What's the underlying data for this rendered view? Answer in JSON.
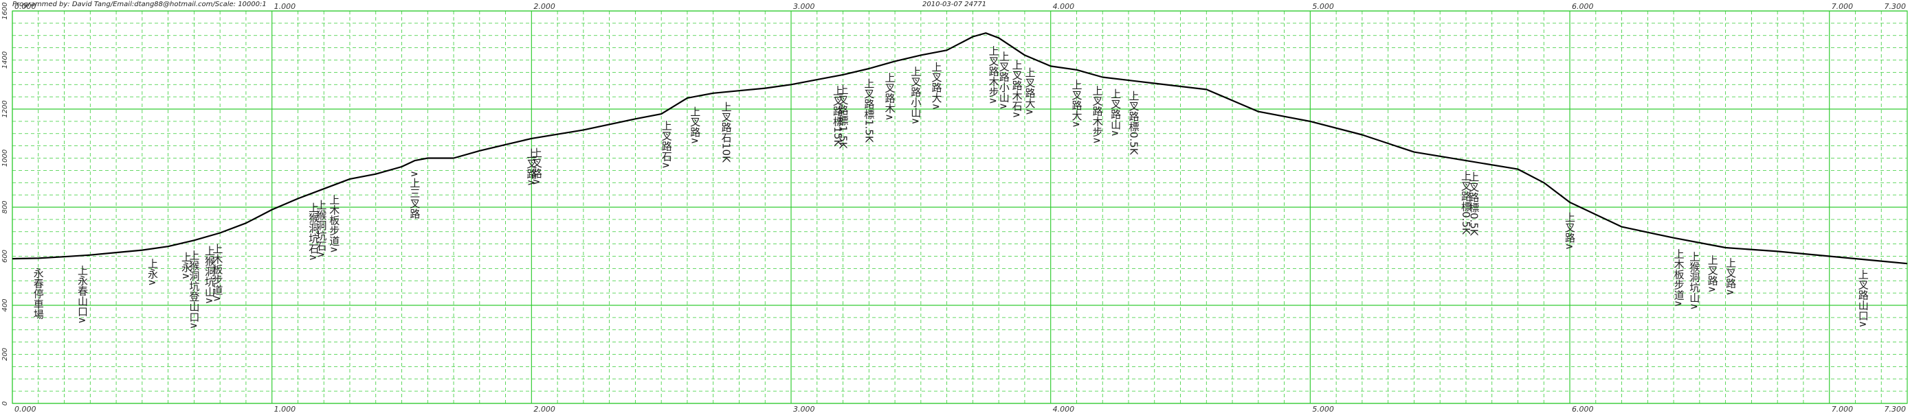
{
  "header": {
    "credit": "Programmed  by:  David  Tang/Email:dtang88@hotmail.com/Scale:  10000:1",
    "timestamp": "2010-03-07 24771"
  },
  "chart_data": {
    "type": "line",
    "title": "",
    "xlabel": "",
    "ylabel": "",
    "xlim": [
      0,
      7.3
    ],
    "ylim": [
      0,
      1600
    ],
    "grid": true,
    "x_ticks": [
      "0.000",
      "1.000",
      "2.000",
      "3.000",
      "4.000",
      "5.000",
      "6.000",
      "7.000",
      "7.300"
    ],
    "y_ticks": [
      "0",
      "200",
      "400",
      "600",
      "800",
      "1000",
      "1200",
      "1400",
      "1600"
    ],
    "series": [
      {
        "x": [
          0,
          0.1,
          0.2,
          0.3,
          0.4,
          0.5,
          0.6,
          0.7,
          0.8,
          0.9,
          1.0,
          1.1,
          1.2,
          1.3,
          1.4,
          1.5,
          1.55,
          1.6,
          1.7,
          1.8,
          1.9,
          2.0,
          2.2,
          2.4,
          2.5,
          2.6,
          2.7,
          2.8,
          2.9,
          3.0,
          3.1,
          3.2,
          3.3,
          3.4,
          3.5,
          3.6,
          3.7,
          3.75,
          3.8,
          3.9,
          4.0,
          4.1,
          4.2,
          4.4,
          4.6,
          4.8,
          5.0,
          5.2,
          5.4,
          5.6,
          5.8,
          5.9,
          6.0,
          6.2,
          6.4,
          6.6,
          6.8,
          7.0,
          7.2,
          7.3
        ],
        "y": [
          590,
          592,
          598,
          605,
          615,
          625,
          640,
          665,
          695,
          735,
          790,
          835,
          875,
          915,
          935,
          965,
          990,
          1000,
          1000,
          1030,
          1055,
          1080,
          1115,
          1160,
          1180,
          1245,
          1265,
          1275,
          1285,
          1300,
          1320,
          1340,
          1365,
          1395,
          1420,
          1440,
          1495,
          1510,
          1490,
          1420,
          1375,
          1360,
          1330,
          1305,
          1280,
          1190,
          1150,
          1095,
          1025,
          990,
          955,
          900,
          820,
          720,
          675,
          635,
          620,
          600,
          580,
          570
        ]
      }
    ],
    "annotations": [
      {
        "x": 0.1,
        "text": "永春停車場"
      },
      {
        "x": 0.27,
        "text": "上永春山口∧"
      },
      {
        "x": 0.54,
        "text": "上永∧"
      },
      {
        "x": 0.67,
        "text": "上永∧"
      },
      {
        "x": 0.7,
        "text": "上猴洞坑登山口∧"
      },
      {
        "x": 0.76,
        "text": "上猴洞坑山∧"
      },
      {
        "x": 0.79,
        "text": "上木板步道∧"
      },
      {
        "x": 1.16,
        "text": "上猴洞坑石∧"
      },
      {
        "x": 1.19,
        "text": "上猴洞坑石∧"
      },
      {
        "x": 1.24,
        "text": "上木板步道∧"
      },
      {
        "x": 1.55,
        "text": "∧上三叉路"
      },
      {
        "x": 2.0,
        "text": "上叉路∧"
      },
      {
        "x": 2.02,
        "text": "上叉路∧"
      },
      {
        "x": 2.52,
        "text": "上叉路石∧"
      },
      {
        "x": 2.63,
        "text": "上叉路∧"
      },
      {
        "x": 2.75,
        "text": "上叉路石10K"
      },
      {
        "x": 3.18,
        "text": "上叉路標15K"
      },
      {
        "x": 3.2,
        "text": "上叉路標1.5K"
      },
      {
        "x": 3.3,
        "text": "上叉路標1.5K"
      },
      {
        "x": 3.38,
        "text": "上叉路木∧"
      },
      {
        "x": 3.48,
        "text": "上叉路小山∧"
      },
      {
        "x": 3.56,
        "text": "上叉路大∧"
      },
      {
        "x": 3.78,
        "text": "上叉路木步∧"
      },
      {
        "x": 3.82,
        "text": "上叉路小山∧"
      },
      {
        "x": 3.87,
        "text": "上叉路木石∧"
      },
      {
        "x": 3.92,
        "text": "上叉路大∧"
      },
      {
        "x": 4.1,
        "text": "上叉路大∧"
      },
      {
        "x": 4.18,
        "text": "上叉路木步∧"
      },
      {
        "x": 4.25,
        "text": "上叉路山∧"
      },
      {
        "x": 4.32,
        "text": "上叉路標0.5K"
      },
      {
        "x": 5.6,
        "text": "上叉路標0.5K"
      },
      {
        "x": 5.63,
        "text": "上叉路標0.5K"
      },
      {
        "x": 6.0,
        "text": "上叉路∧"
      },
      {
        "x": 6.42,
        "text": "上木板步道∧"
      },
      {
        "x": 6.48,
        "text": "上猴洞坑山∧"
      },
      {
        "x": 6.55,
        "text": "上叉路∧"
      },
      {
        "x": 6.62,
        "text": "上叉路∧"
      },
      {
        "x": 7.13,
        "text": "上叉路山口∧"
      }
    ]
  }
}
